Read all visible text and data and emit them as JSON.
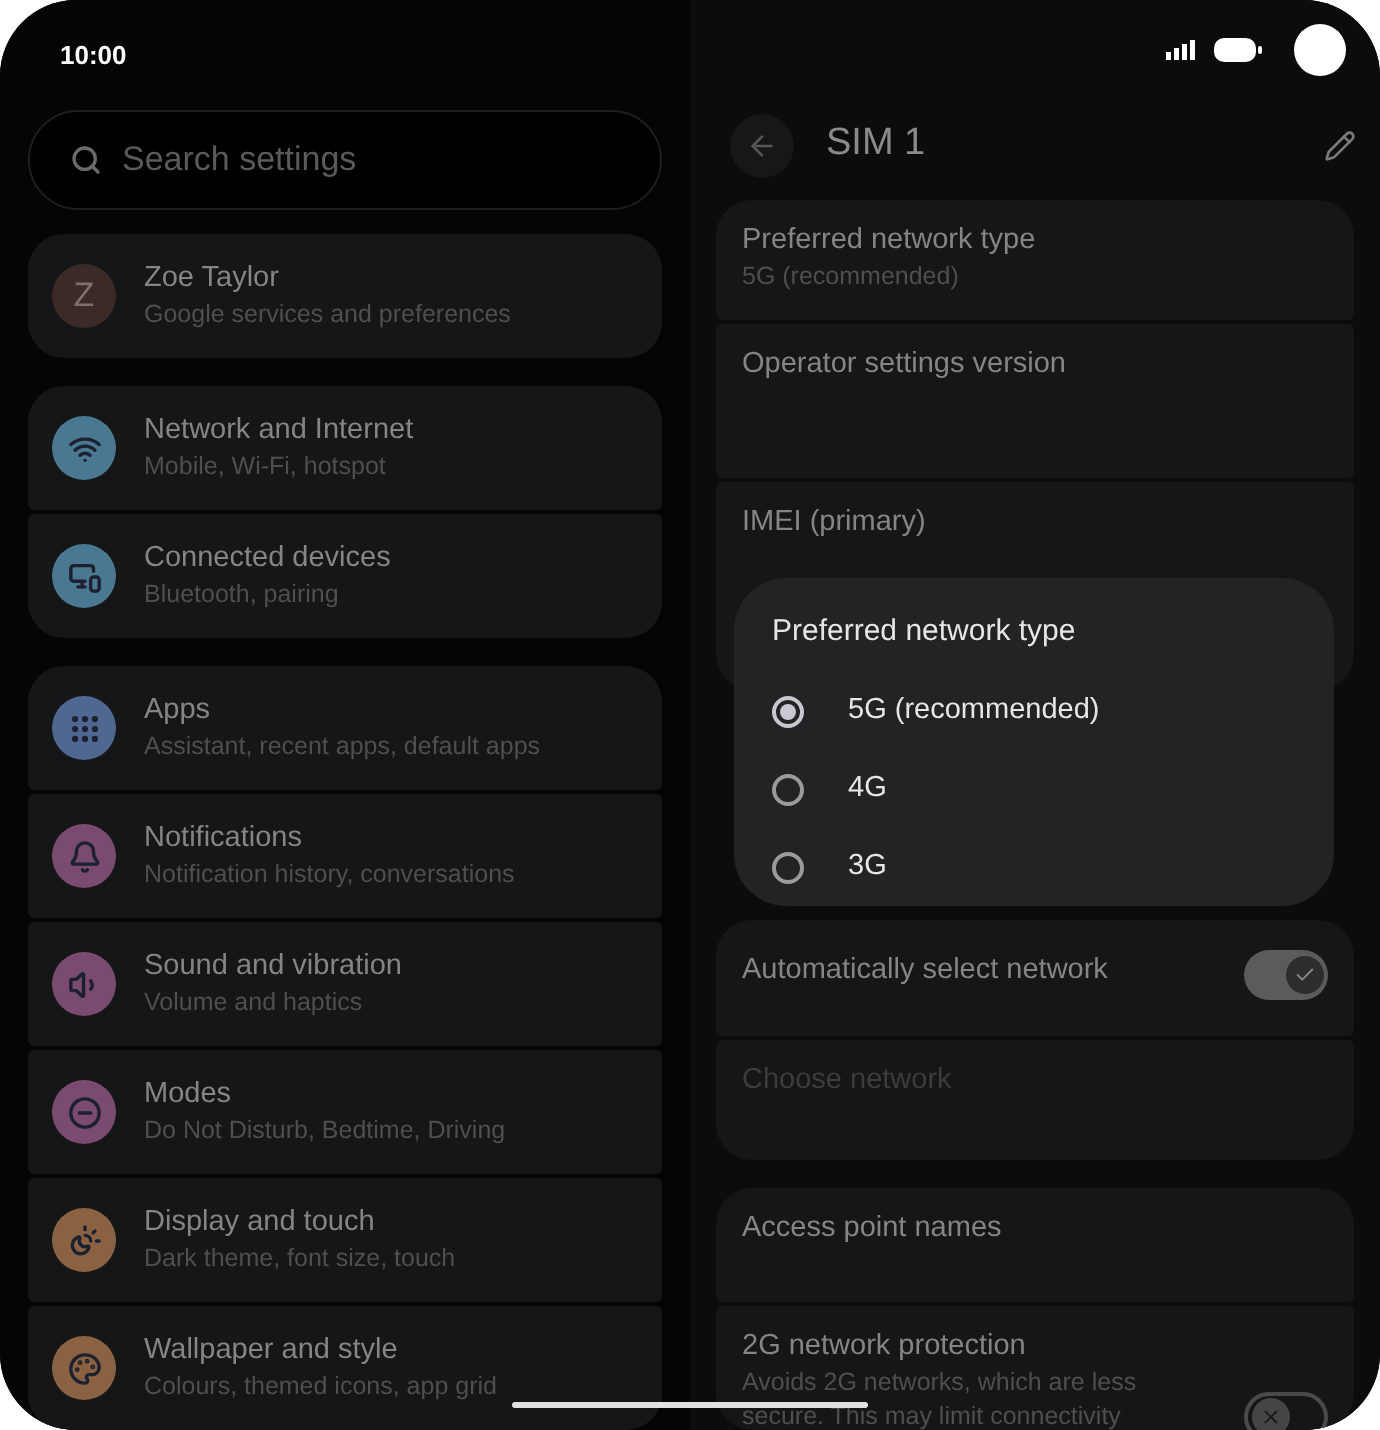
{
  "status_bar": {
    "time": "10:00"
  },
  "search": {
    "placeholder": "Search settings"
  },
  "settings_groups": [
    {
      "items": [
        {
          "kind": "avatar",
          "initial": "Z",
          "title": "Zoe Taylor",
          "subtitle": "Google services and preferences",
          "color": "#3b2a27"
        }
      ]
    },
    {
      "items": [
        {
          "kind": "icon",
          "title": "Network and Internet",
          "subtitle": "Mobile, Wi-Fi, hotspot",
          "color": "#4b7891"
        },
        {
          "kind": "icon",
          "title": "Connected devices",
          "subtitle": "Bluetooth, pairing",
          "color": "#4b7891"
        }
      ]
    },
    {
      "items": [
        {
          "kind": "icon",
          "title": "Apps",
          "subtitle": "Assistant, recent apps, default apps",
          "color": "#4f6791"
        },
        {
          "kind": "icon",
          "title": "Notifications",
          "subtitle": "Notification history, conversations",
          "color": "#7b4a70"
        },
        {
          "kind": "icon",
          "title": "Sound and vibration",
          "subtitle": "Volume and haptics",
          "color": "#7b4a70"
        },
        {
          "kind": "icon",
          "title": "Modes",
          "subtitle": "Do Not Disturb, Bedtime, Driving",
          "color": "#7b4a70"
        },
        {
          "kind": "icon",
          "title": "Display and touch",
          "subtitle": "Dark theme, font size, touch",
          "color": "#8a6242"
        },
        {
          "kind": "icon",
          "title": "Wallpaper and style",
          "subtitle": "Colours, themed icons, app grid",
          "color": "#8a6242"
        }
      ]
    }
  ],
  "sim_page": {
    "title": "SIM 1",
    "groups": [
      {
        "items": [
          {
            "kind": "text",
            "title": "Preferred network type",
            "subtitle": "5G (recommended)",
            "disabled": false
          },
          {
            "kind": "text",
            "title": "Operator settings version",
            "disabled": false
          },
          {
            "kind": "text",
            "title": "IMEI (primary)",
            "disabled": false
          }
        ]
      },
      {
        "items": [
          {
            "kind": "switch",
            "title": "Automatically select network",
            "on": true
          },
          {
            "kind": "text",
            "title": "Choose network",
            "disabled": true
          }
        ]
      },
      {
        "items": [
          {
            "kind": "text",
            "title": "Access point names",
            "disabled": false
          },
          {
            "kind": "switch",
            "title": "2G network protection",
            "subtitle": "Avoids 2G networks, which are less secure. This may limit connectivity",
            "on": false
          }
        ]
      }
    ]
  },
  "dialog": {
    "title": "Preferred network type",
    "options": [
      {
        "label": "5G (recommended)",
        "selected": true
      },
      {
        "label": "4G",
        "selected": false
      },
      {
        "label": "3G",
        "selected": false
      }
    ]
  }
}
